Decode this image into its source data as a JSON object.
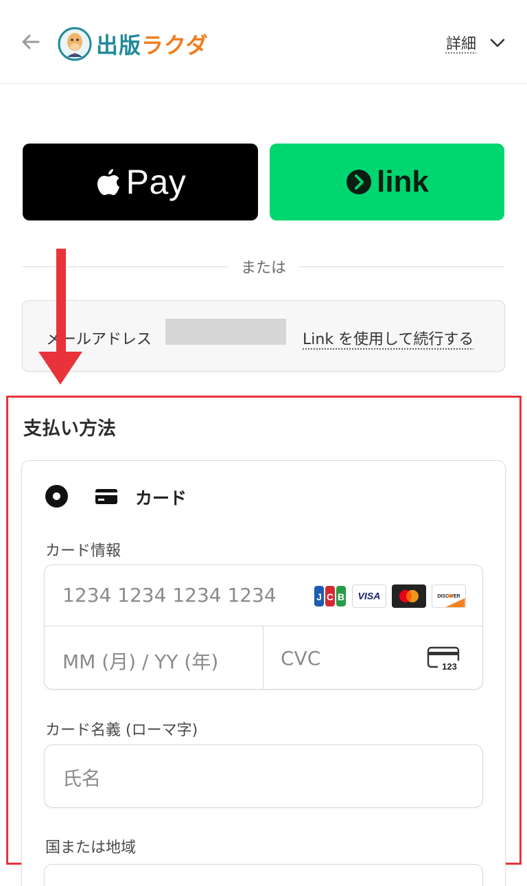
{
  "header": {
    "logo_text_part1": "出版",
    "logo_text_part2": "ラクダ",
    "details_label": "詳細"
  },
  "express": {
    "apple_pay_label": "Pay",
    "link_label": "link"
  },
  "divider_text": "または",
  "email_row": {
    "label": "メールアドレス",
    "link_text": "Link を使用して続行する"
  },
  "payment": {
    "section_title": "支払い方法",
    "method_label": "カード",
    "card_info_label": "カード情報",
    "card_number_placeholder": "1234 1234 1234 1234",
    "expiry_placeholder": "MM (月) / YY (年)",
    "cvc_placeholder": "CVC",
    "cvc_icon_text": "123",
    "card_brands": [
      "JCB",
      "VISA",
      "Mastercard",
      "DISCOVER"
    ],
    "cardholder_label": "カード名義 (ローマ字)",
    "cardholder_placeholder": "氏名",
    "country_label": "国または地域"
  },
  "colors": {
    "link_green": "#00d66f",
    "highlight_red": "#e8333a",
    "logo_teal": "#1e8a9a",
    "logo_orange": "#f07d1b"
  }
}
